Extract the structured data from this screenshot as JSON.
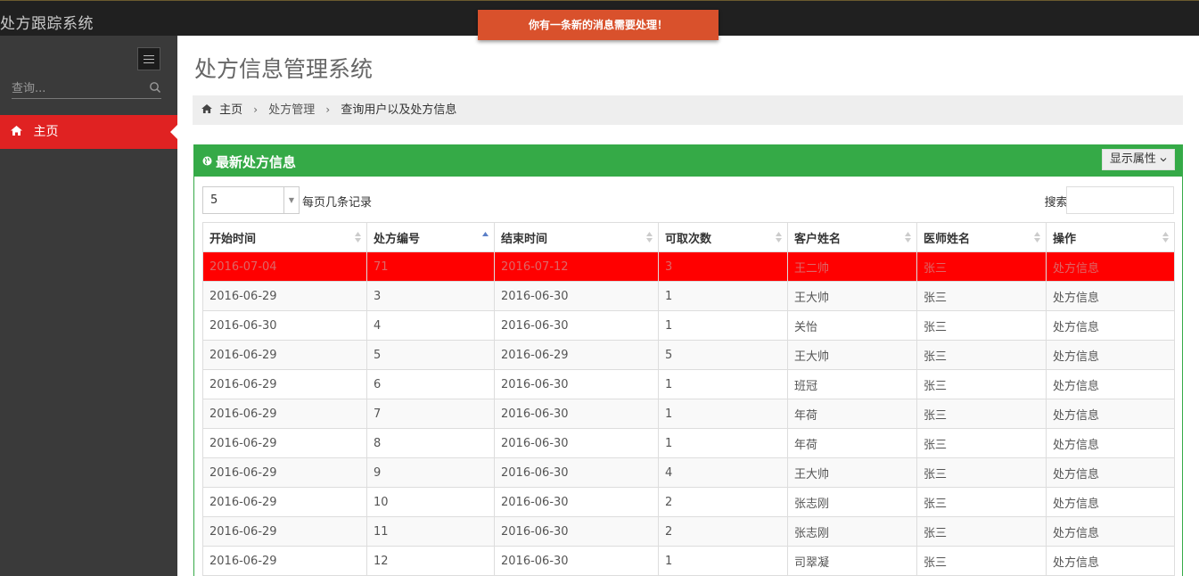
{
  "app": {
    "title": "处方跟踪系统"
  },
  "toast": {
    "text": "你有一条新的消息需要处理！"
  },
  "sidebar": {
    "search_placeholder": "查询...",
    "home_label": "主页"
  },
  "main": {
    "page_title": "处方信息管理系统",
    "breadcrumb": [
      "主页",
      "处方管理",
      "查询用户以及处方信息"
    ]
  },
  "portlet": {
    "title": "最新处方信息",
    "show_attr_button": "显示属性",
    "page_length_value": "5",
    "page_length_label": "每页几条记录",
    "search_label": "搜索:"
  },
  "table": {
    "columns": [
      "开始时间",
      "处方编号",
      "结束时间",
      "可取次数",
      "客户姓名",
      "医师姓名",
      "操作"
    ],
    "sorted_column_index": 1,
    "rows": [
      [
        "2016-07-04",
        "71",
        "2016-07-12",
        "3",
        "王二帅",
        "张三",
        "处方信息"
      ],
      [
        "2016-06-29",
        "3",
        "2016-06-30",
        "1",
        "王大帅",
        "张三",
        "处方信息"
      ],
      [
        "2016-06-30",
        "4",
        "2016-06-30",
        "1",
        "关怡",
        "张三",
        "处方信息"
      ],
      [
        "2016-06-29",
        "5",
        "2016-06-29",
        "5",
        "王大帅",
        "张三",
        "处方信息"
      ],
      [
        "2016-06-29",
        "6",
        "2016-06-30",
        "1",
        "班冠",
        "张三",
        "处方信息"
      ],
      [
        "2016-06-29",
        "7",
        "2016-06-30",
        "1",
        "年荷",
        "张三",
        "处方信息"
      ],
      [
        "2016-06-29",
        "8",
        "2016-06-30",
        "1",
        "年荷",
        "张三",
        "处方信息"
      ],
      [
        "2016-06-29",
        "9",
        "2016-06-30",
        "4",
        "王大帅",
        "张三",
        "处方信息"
      ],
      [
        "2016-06-29",
        "10",
        "2016-06-30",
        "2",
        "张志刚",
        "张三",
        "处方信息"
      ],
      [
        "2016-06-29",
        "11",
        "2016-06-30",
        "2",
        "张志刚",
        "张三",
        "处方信息"
      ],
      [
        "2016-06-29",
        "12",
        "2016-06-30",
        "1",
        "司翠凝",
        "张三",
        "处方信息"
      ]
    ]
  },
  "colors": {
    "topbar": "#202020",
    "sidebar": "#3a3a3a",
    "accent_red": "#e02222",
    "toast": "#d9512c",
    "portlet_green": "#35aa47",
    "highlight_row": "#ff0000"
  }
}
